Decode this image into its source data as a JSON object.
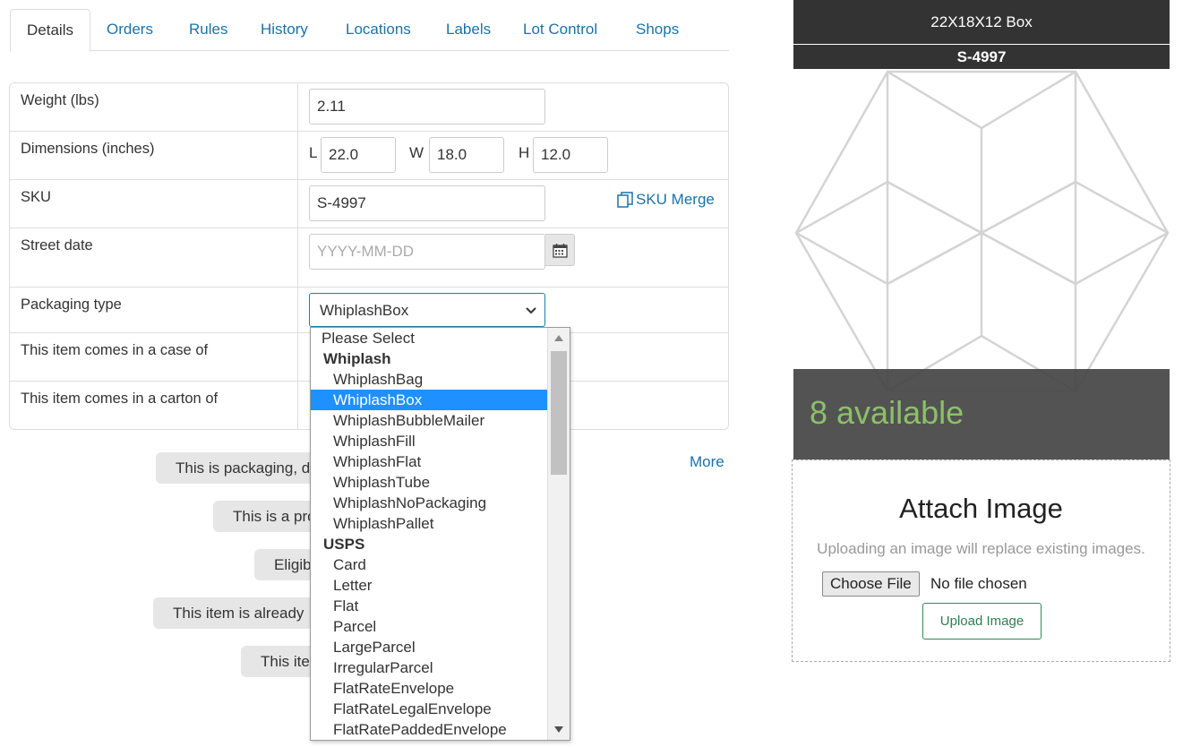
{
  "tabs": [
    {
      "label": "Details"
    },
    {
      "label": "Orders"
    },
    {
      "label": "Rules"
    },
    {
      "label": "History"
    },
    {
      "label": "Locations"
    },
    {
      "label": "Labels"
    },
    {
      "label": "Lot Control"
    },
    {
      "label": "Shops"
    }
  ],
  "form": {
    "weight": {
      "label": "Weight (lbs)",
      "value": "2.11"
    },
    "dimensions": {
      "label": "Dimensions (inches)",
      "l_label": "L",
      "l_value": "22.0",
      "w_label": "W",
      "w_value": "18.0",
      "h_label": "H",
      "h_value": "12.0"
    },
    "sku": {
      "label": "SKU",
      "value": "S-4997",
      "merge_label": "SKU Merge"
    },
    "street_date": {
      "label": "Street date",
      "placeholder": "YYYY-MM-DD"
    },
    "packaging_type": {
      "label": "Packaging type",
      "selected": "WhiplashBox"
    },
    "case_of": {
      "label": "This item comes in a case of"
    },
    "carton_of": {
      "label": "This item comes in a carton of"
    }
  },
  "pills": [
    {
      "text": "This is packaging, de"
    },
    {
      "text": "This is a pro"
    },
    {
      "text": "Eligib"
    },
    {
      "text": "This item is already"
    },
    {
      "text": "This ite"
    }
  ],
  "more_label": "More",
  "dropdown": {
    "options": [
      {
        "text": "Please Select",
        "kind": "plain"
      },
      {
        "text": "Whiplash",
        "kind": "group"
      },
      {
        "text": "WhiplashBag",
        "kind": "child"
      },
      {
        "text": "WhiplashBox",
        "kind": "child",
        "selected": true
      },
      {
        "text": "WhiplashBubbleMailer",
        "kind": "child"
      },
      {
        "text": "WhiplashFill",
        "kind": "child"
      },
      {
        "text": "WhiplashFlat",
        "kind": "child"
      },
      {
        "text": "WhiplashTube",
        "kind": "child"
      },
      {
        "text": "WhiplashNoPackaging",
        "kind": "child"
      },
      {
        "text": "WhiplashPallet",
        "kind": "child"
      },
      {
        "text": "USPS",
        "kind": "group"
      },
      {
        "text": "Card",
        "kind": "child"
      },
      {
        "text": "Letter",
        "kind": "child"
      },
      {
        "text": "Flat",
        "kind": "child"
      },
      {
        "text": "Parcel",
        "kind": "child"
      },
      {
        "text": "LargeParcel",
        "kind": "child"
      },
      {
        "text": "IrregularParcel",
        "kind": "child"
      },
      {
        "text": "FlatRateEnvelope",
        "kind": "child"
      },
      {
        "text": "FlatRateLegalEnvelope",
        "kind": "child"
      },
      {
        "text": "FlatRatePaddedEnvelope",
        "kind": "child"
      }
    ]
  },
  "product_card": {
    "title": "22X18X12 Box",
    "sku": "S-4997",
    "available": "8 available"
  },
  "attach": {
    "title": "Attach Image",
    "hint": "Uploading an image will replace existing images.",
    "choose_label": "Choose File",
    "no_file": "No file chosen",
    "upload_label": "Upload Image"
  },
  "colors": {
    "link": "#1a73a8",
    "selected_option": "#1e90ff",
    "available_text": "#8cc06a",
    "card_header": "#333333"
  }
}
